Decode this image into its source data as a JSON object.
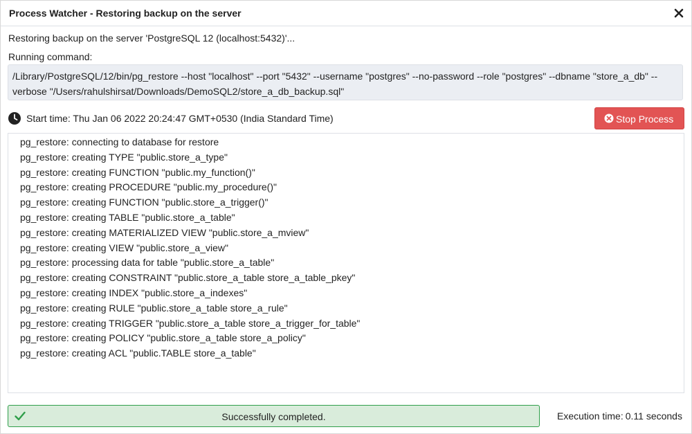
{
  "window": {
    "title": "Process Watcher - Restoring backup on the server"
  },
  "restore_message": "Restoring backup on the server 'PostgreSQL 12 (localhost:5432)'...",
  "running_command_label": "Running command:",
  "command": "/Library/PostgreSQL/12/bin/pg_restore --host \"localhost\" --port \"5432\" --username \"postgres\" --no-password --role \"postgres\" --dbname \"store_a_db\" --verbose \"/Users/rahulshirsat/Downloads/DemoSQL2/store_a_db_backup.sql\"",
  "start_time": "Start time: Thu Jan 06 2022 20:24:47 GMT+0530 (India Standard Time)",
  "stop_button_label": "Stop Process",
  "log_lines": [
    "pg_restore: connecting to database for restore",
    "pg_restore: creating TYPE \"public.store_a_type\"",
    "pg_restore: creating FUNCTION \"public.my_function()\"",
    "pg_restore: creating PROCEDURE \"public.my_procedure()\"",
    "pg_restore: creating FUNCTION \"public.store_a_trigger()\"",
    "pg_restore: creating TABLE \"public.store_a_table\"",
    "pg_restore: creating MATERIALIZED VIEW \"public.store_a_mview\"",
    "pg_restore: creating VIEW \"public.store_a_view\"",
    "pg_restore: processing data for table \"public.store_a_table\"",
    "pg_restore: creating CONSTRAINT \"public.store_a_table store_a_table_pkey\"",
    "pg_restore: creating INDEX \"public.store_a_indexes\"",
    "pg_restore: creating RULE \"public.store_a_table store_a_rule\"",
    "pg_restore: creating TRIGGER \"public.store_a_table store_a_trigger_for_table\"",
    "pg_restore: creating POLICY \"public.store_a_table store_a_policy\"",
    "pg_restore: creating ACL \"public.TABLE store_a_table\""
  ],
  "status": {
    "message": "Successfully completed.",
    "color": "#2f9e4a"
  },
  "execution_time": {
    "label": "Execution time:",
    "value": "0.11 seconds"
  },
  "colors": {
    "stop_button": "#e25454",
    "status_background": "#d9ecdb",
    "command_background": "#ebeef3"
  },
  "icons": {
    "close": "close-icon",
    "clock": "clock-icon",
    "stop": "times-circle-icon",
    "success": "check-icon"
  }
}
